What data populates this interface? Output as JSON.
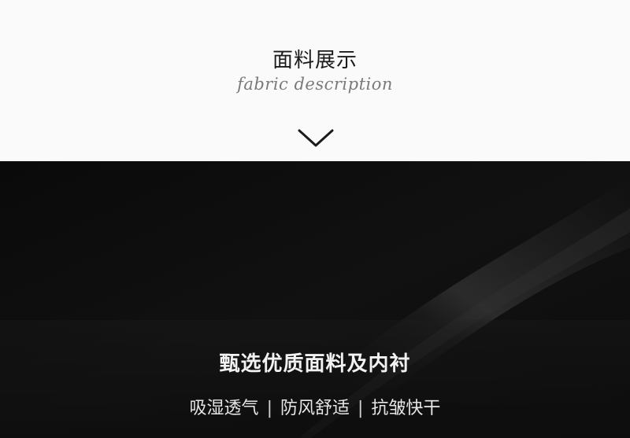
{
  "section": {
    "title": "面料展示",
    "subtitle": "fabric description",
    "chevron_icon": "chevron-down-icon"
  },
  "fabric_image": {
    "description_headline": "甄选优质面料及内衬",
    "features": [
      "吸湿透气",
      "防风舒适",
      "抗皱快干"
    ],
    "separator": "|"
  },
  "colors": {
    "header_bg": "#fafafa",
    "fabric_dark": "#0b0b0b",
    "text_light": "#f2f2f2"
  }
}
